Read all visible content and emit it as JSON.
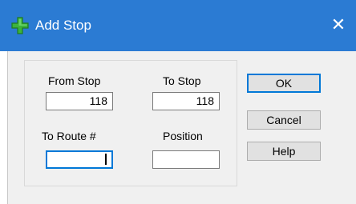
{
  "window": {
    "title": "Add Stop",
    "close_glyph": "✕",
    "title_icon": "green-plus-icon",
    "accent_color": "#2b7bd3"
  },
  "fields": {
    "from_stop": {
      "label": "From Stop",
      "value": "118"
    },
    "to_stop": {
      "label": "To Stop",
      "value": "118"
    },
    "to_route": {
      "label": "To Route #",
      "value": ""
    },
    "position": {
      "label": "Position",
      "value": ""
    }
  },
  "buttons": {
    "ok": "OK",
    "cancel": "Cancel",
    "help": "Help"
  }
}
